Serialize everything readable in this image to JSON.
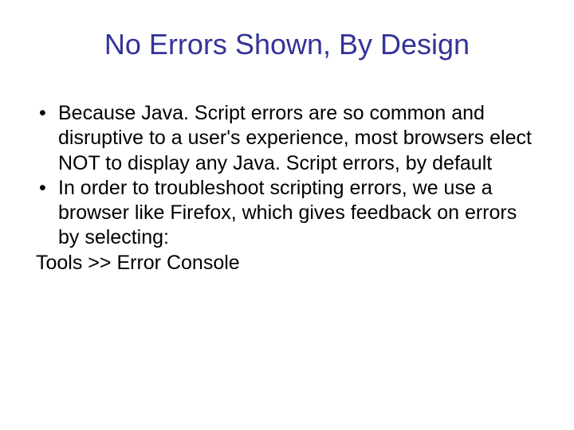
{
  "title": "No Errors Shown, By Design",
  "bullets": [
    "Because Java. Script errors are so common and disruptive to a user's experience, most browsers elect NOT to display any Java. Script errors, by default",
    "In order to troubleshoot scripting errors, we use a browser like Firefox, which gives feedback on errors by selecting:"
  ],
  "final_line": "Tools >> Error Console"
}
